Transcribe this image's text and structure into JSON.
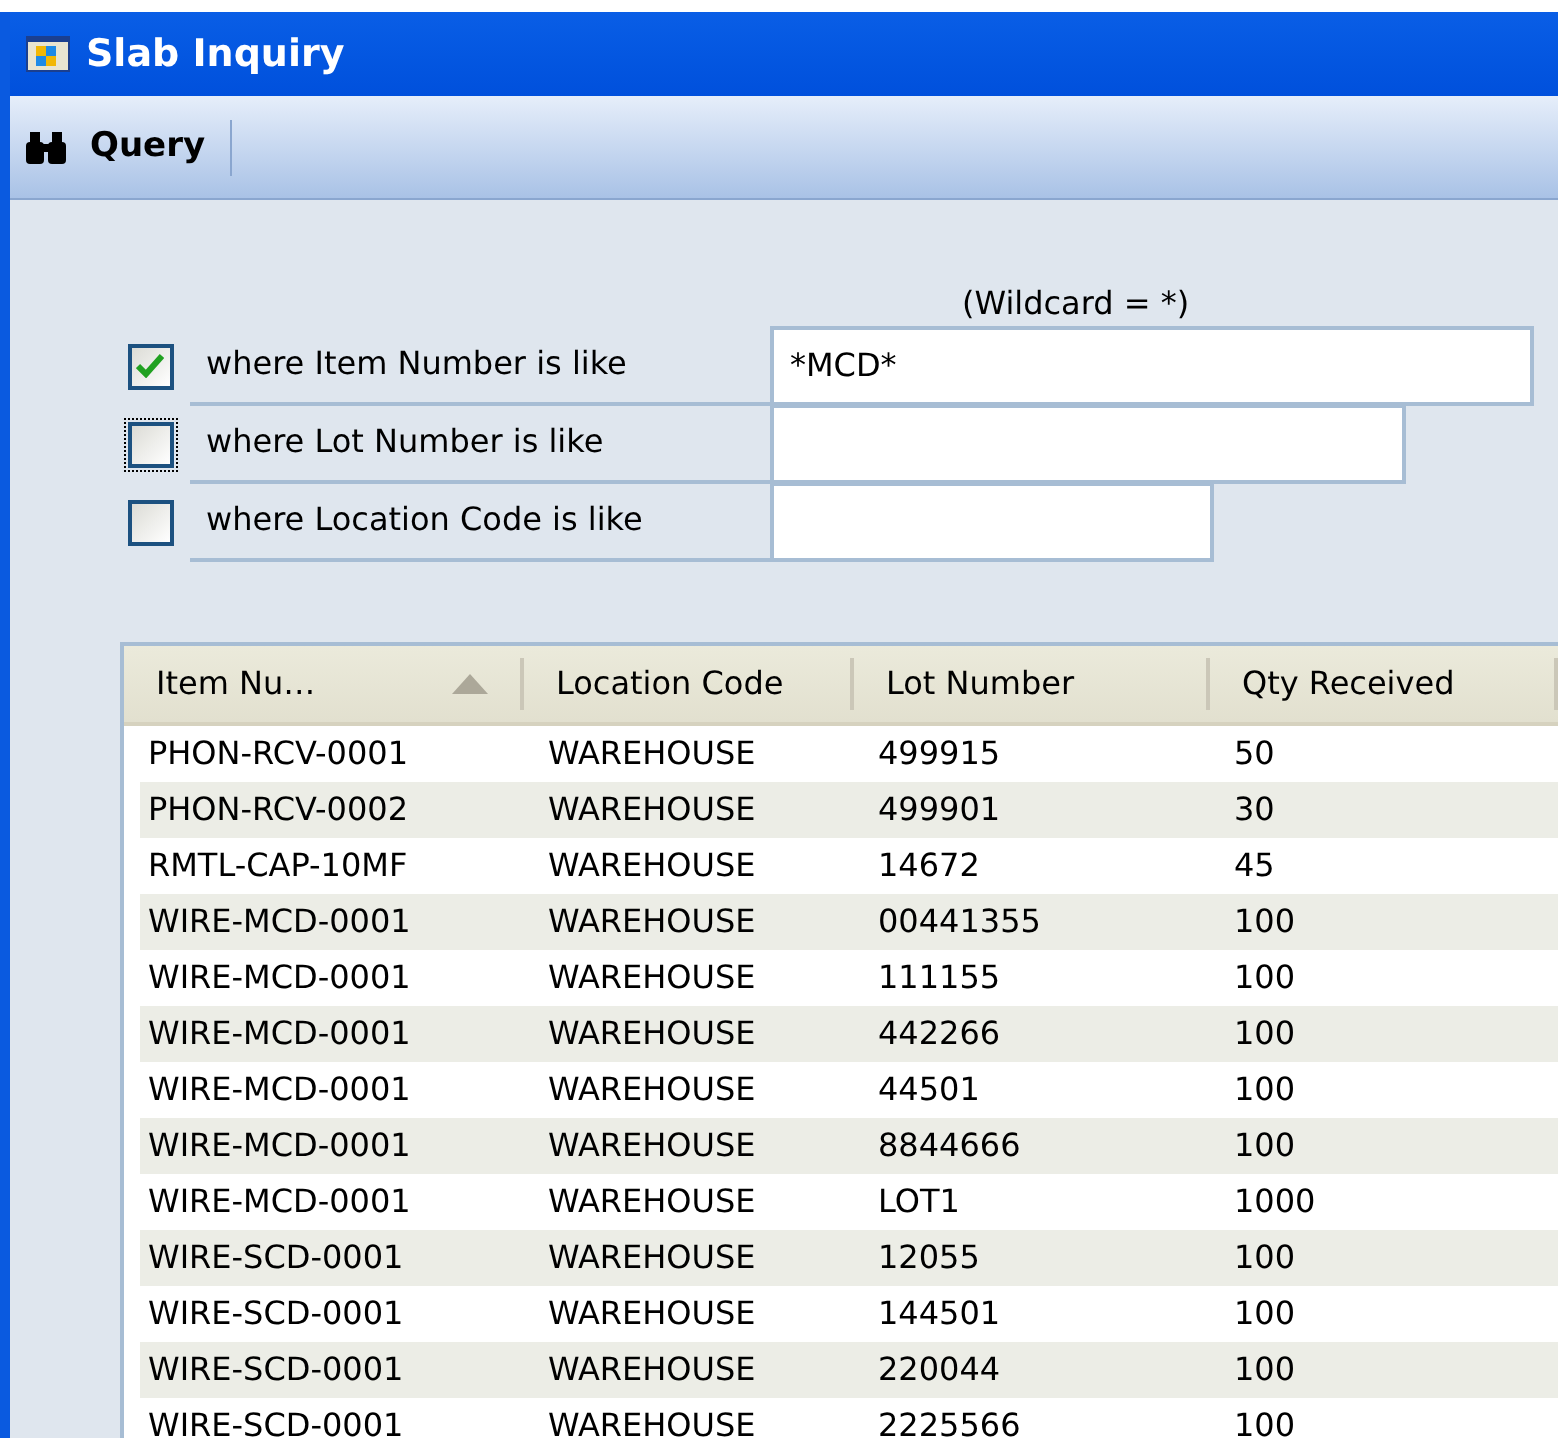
{
  "window": {
    "title": "Slab Inquiry"
  },
  "toolbar": {
    "query_button": "Query"
  },
  "filters": {
    "hint": "(Wildcard = *)",
    "rows": [
      {
        "label": "where Item Number is like",
        "checked": true,
        "focused": false,
        "value": "*MCD*"
      },
      {
        "label": "where Lot Number is like",
        "checked": false,
        "focused": true,
        "value": ""
      },
      {
        "label": "where Location Code is like",
        "checked": false,
        "focused": false,
        "value": ""
      }
    ]
  },
  "table": {
    "columns": [
      {
        "label": "Item Nu…",
        "sorted": true
      },
      {
        "label": "Location Code",
        "sorted": false
      },
      {
        "label": "Lot Number",
        "sorted": false
      },
      {
        "label": "Qty Received",
        "sorted": false
      }
    ],
    "rows": [
      [
        "PHON-RCV-0001",
        "WAREHOUSE",
        "499915",
        "50"
      ],
      [
        "PHON-RCV-0002",
        "WAREHOUSE",
        "499901",
        "30"
      ],
      [
        "RMTL-CAP-10MF",
        "WAREHOUSE",
        "14672",
        "45"
      ],
      [
        "WIRE-MCD-0001",
        "WAREHOUSE",
        "00441355",
        "100"
      ],
      [
        "WIRE-MCD-0001",
        "WAREHOUSE",
        "111155",
        "100"
      ],
      [
        "WIRE-MCD-0001",
        "WAREHOUSE",
        "442266",
        "100"
      ],
      [
        "WIRE-MCD-0001",
        "WAREHOUSE",
        "44501",
        "100"
      ],
      [
        "WIRE-MCD-0001",
        "WAREHOUSE",
        "8844666",
        "100"
      ],
      [
        "WIRE-MCD-0001",
        "WAREHOUSE",
        "LOT1",
        "1000"
      ],
      [
        "WIRE-SCD-0001",
        "WAREHOUSE",
        "12055",
        "100"
      ],
      [
        "WIRE-SCD-0001",
        "WAREHOUSE",
        "144501",
        "100"
      ],
      [
        "WIRE-SCD-0001",
        "WAREHOUSE",
        "220044",
        "100"
      ],
      [
        "WIRE-SCD-0001",
        "WAREHOUSE",
        "2225566",
        "100"
      ]
    ]
  }
}
